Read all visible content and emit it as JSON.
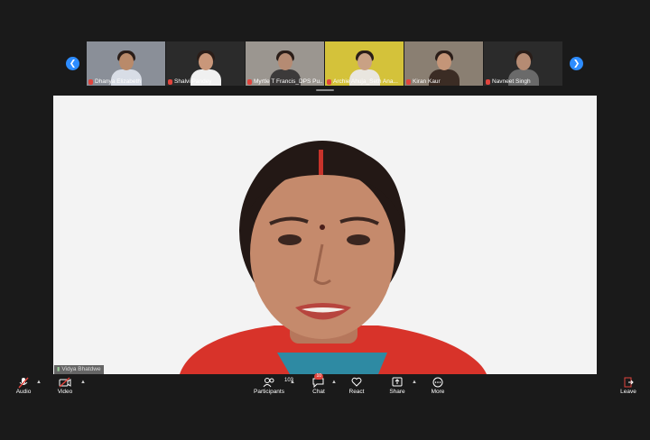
{
  "participants_strip": [
    {
      "name": "Dhanya Elizabeth",
      "bg": "#8a8f98",
      "torso": "#d8dde6",
      "head": "#b98a6a"
    },
    {
      "name": "Shalvi Pandey",
      "bg": "#2b2b2b",
      "torso": "#f0f0f0",
      "head": "#c9977a"
    },
    {
      "name": "Myrtle T Francis_DPS Pu...",
      "bg": "#9b9690",
      "torso": "#3c3a3a",
      "head": "#b58b73"
    },
    {
      "name": "Archie Ahuja_Seth Ana...",
      "bg": "#d4c23a",
      "torso": "#e9e6df",
      "head": "#c9a184"
    },
    {
      "name": "Kiran Kaur",
      "bg": "#8a7f72",
      "torso": "#3b2c24",
      "head": "#c49578"
    },
    {
      "name": "Navneet Singh",
      "bg": "#2b2b2b",
      "torso": "#6a6a6a",
      "head": "#b58b73"
    }
  ],
  "speaker": {
    "name": "Vidya Bhatdwe"
  },
  "toolbar": {
    "audio": "Audio",
    "video": "Video",
    "participants": "Participants",
    "participants_count": "103",
    "chat": "Chat",
    "chat_badge": "10",
    "react": "React",
    "share": "Share",
    "more": "More",
    "leave": "Leave"
  },
  "colors": {
    "accent": "#2d8cff",
    "muted": "#e0443d",
    "leave": "#e0443d"
  }
}
